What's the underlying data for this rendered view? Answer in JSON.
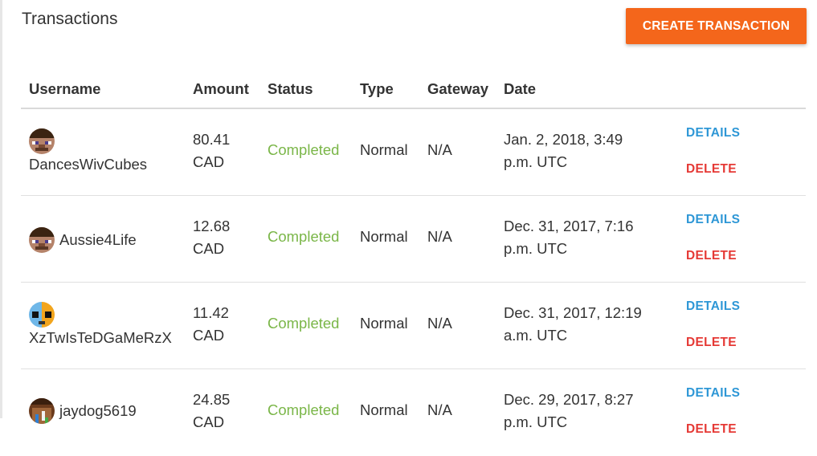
{
  "page": {
    "title": "Transactions"
  },
  "toolbar": {
    "create_label": "CREATE TRANSACTION"
  },
  "table": {
    "headers": {
      "username": "Username",
      "amount": "Amount",
      "status": "Status",
      "type": "Type",
      "gateway": "Gateway",
      "date": "Date"
    },
    "rows": [
      {
        "username": "DancesWivCubes",
        "amount_value": "80.41",
        "amount_currency": "CAD",
        "status": "Completed",
        "type": "Normal",
        "gateway": "N/A",
        "date_line1": "Jan. 2, 2018, 3:49",
        "date_line2": "p.m. UTC",
        "details_label": "DETAILS",
        "delete_label": "DELETE",
        "avatar_icon": "steve-avatar-icon"
      },
      {
        "username": "Aussie4Life",
        "amount_value": "12.68",
        "amount_currency": "CAD",
        "status": "Completed",
        "type": "Normal",
        "gateway": "N/A",
        "date_line1": "Dec. 31, 2017, 7:16",
        "date_line2": "p.m. UTC",
        "details_label": "DETAILS",
        "delete_label": "DELETE",
        "avatar_icon": "steve-avatar-icon"
      },
      {
        "username": "XzTwIsTeDGaMeRzX",
        "amount_value": "11.42",
        "amount_currency": "CAD",
        "status": "Completed",
        "type": "Normal",
        "gateway": "N/A",
        "date_line1": "Dec. 31, 2017, 12:19",
        "date_line2": "a.m. UTC",
        "details_label": "DETAILS",
        "delete_label": "DELETE",
        "avatar_icon": "split-face-avatar-icon"
      },
      {
        "username": "jaydog5619",
        "amount_value": "24.85",
        "amount_currency": "CAD",
        "status": "Completed",
        "type": "Normal",
        "gateway": "N/A",
        "date_line1": "Dec. 29, 2017, 8:27",
        "date_line2": "p.m. UTC",
        "details_label": "DETAILS",
        "delete_label": "DELETE",
        "avatar_icon": "pixel-avatar-icon"
      }
    ]
  },
  "colors": {
    "accent": "#f4661b",
    "completed": "#7ab648",
    "details": "#2e97d6",
    "delete": "#e53935"
  }
}
